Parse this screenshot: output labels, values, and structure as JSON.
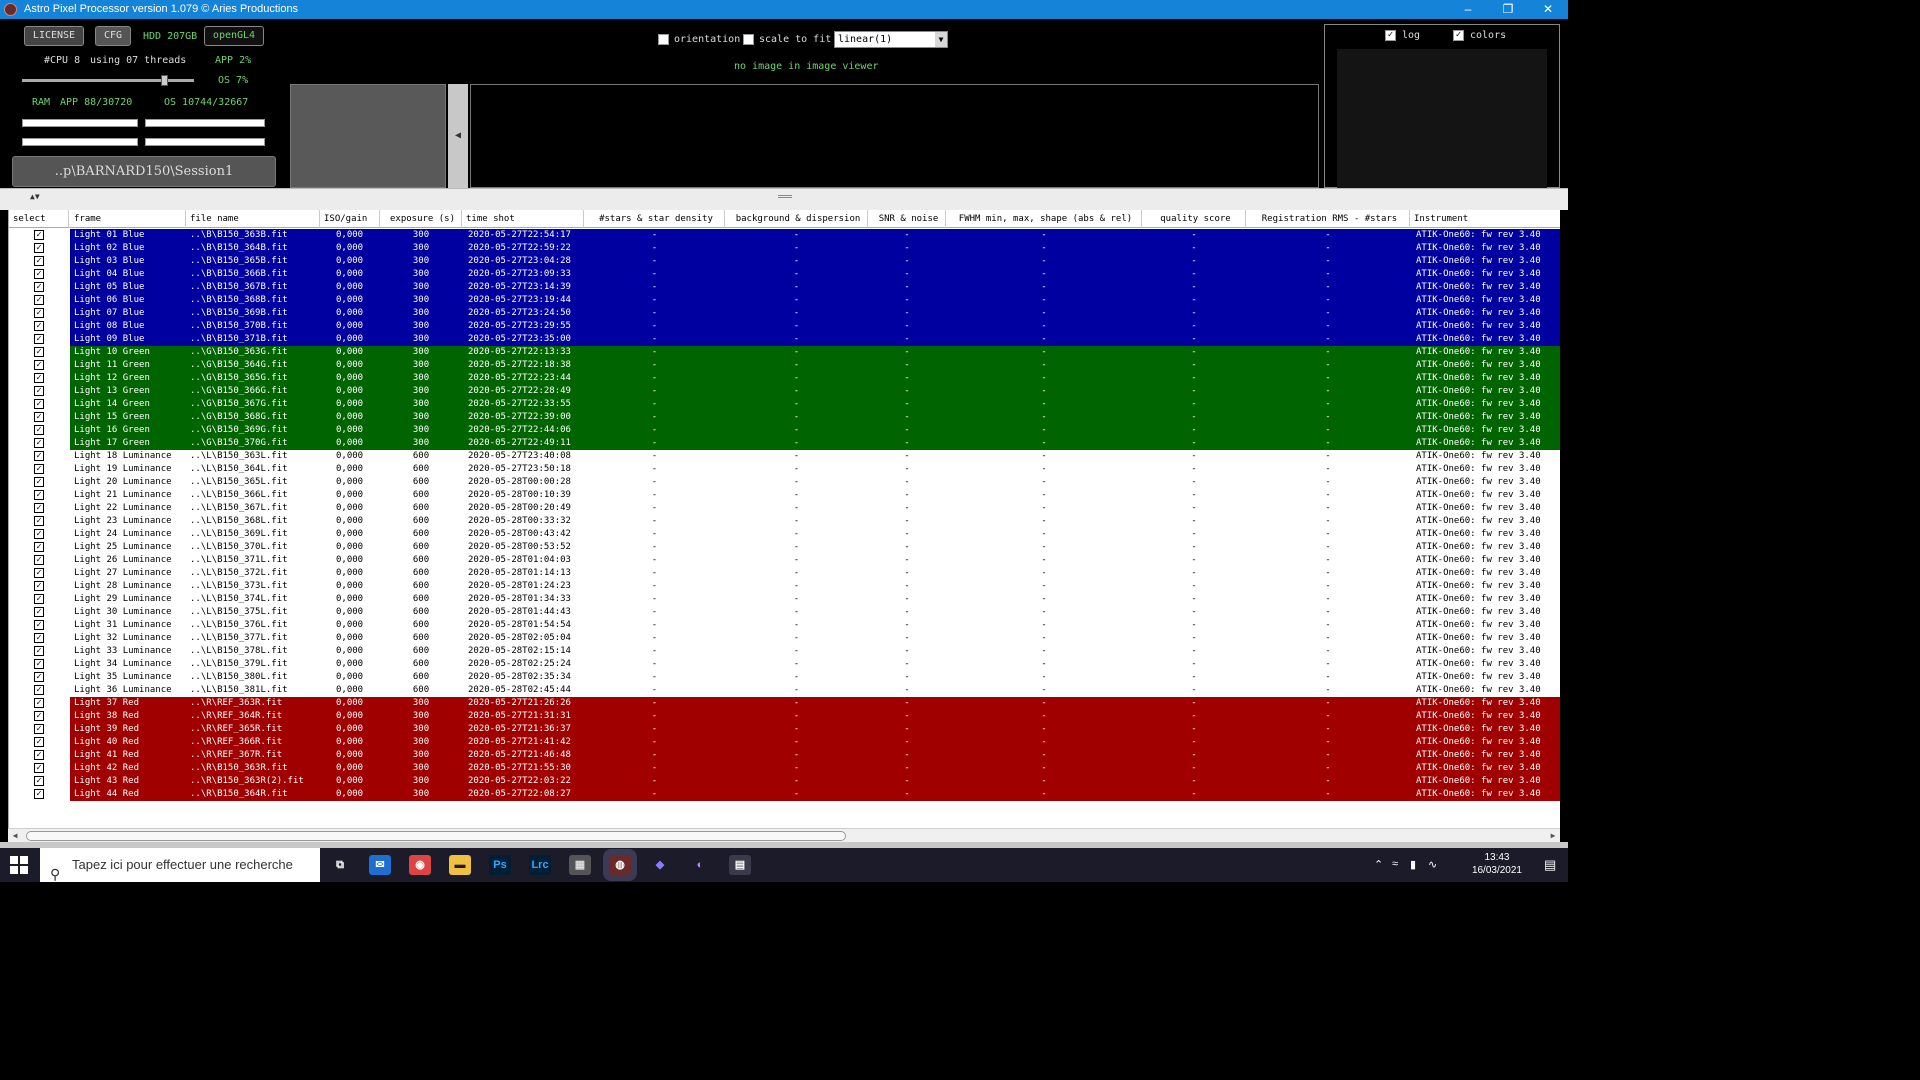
{
  "window": {
    "title": "Astro Pixel Processor version 1.079 © Aries Productions"
  },
  "top": {
    "license_label": "LICENSE",
    "cfg_label": "CFG",
    "hdd_label": "HDD 207GB",
    "opengl_label": "openGL4",
    "cpu_text": "#CPU 8",
    "threads_text": "using 07 threads",
    "app_cpu": "APP 2%",
    "os_cpu": "OS 7%",
    "ram_label": "RAM",
    "ram_app": "APP 88/30720",
    "ram_os": "OS 10744/32667",
    "session": "..p\\BARNARD150\\Session1",
    "orientation_label": "orientation",
    "scale_label": "scale to fit",
    "stretch_value": "linear(1)",
    "no_image": "no image in image viewer",
    "log_label": "log",
    "colors_label": "colors"
  },
  "colors": {
    "blue": "#0000a0",
    "green": "#006400",
    "red": "#a00000",
    "white": "#ffffff"
  },
  "table": {
    "headers": [
      "select",
      "frame",
      "file name",
      "ISO/gain",
      "exposure (s)",
      "time shot",
      "#stars & star density",
      "background & dispersion",
      "SNR & noise",
      "FWHM min, max, shape (abs & rel)",
      "quality score",
      "Registration RMS - #stars",
      "Instrument"
    ],
    "rows": [
      {
        "frame": "Light 01 Blue",
        "file": "..\\B\\B150_363B.fit",
        "iso": "0,000",
        "exp": "300",
        "time": "2020-05-27T22:54:17",
        "stars": "-",
        "bg": "-",
        "snr": "-",
        "fwhm": "-",
        "q": "-",
        "reg": "-",
        "inst": "ATIK-One60: fw rev 3.40",
        "color": "blue"
      },
      {
        "frame": "Light 02 Blue",
        "file": "..\\B\\B150_364B.fit",
        "iso": "0,000",
        "exp": "300",
        "time": "2020-05-27T22:59:22",
        "stars": "-",
        "bg": "-",
        "snr": "-",
        "fwhm": "-",
        "q": "-",
        "reg": "-",
        "inst": "ATIK-One60: fw rev 3.40",
        "color": "blue"
      },
      {
        "frame": "Light 03 Blue",
        "file": "..\\B\\B150_365B.fit",
        "iso": "0,000",
        "exp": "300",
        "time": "2020-05-27T23:04:28",
        "stars": "-",
        "bg": "-",
        "snr": "-",
        "fwhm": "-",
        "q": "-",
        "reg": "-",
        "inst": "ATIK-One60: fw rev 3.40",
        "color": "blue"
      },
      {
        "frame": "Light 04 Blue",
        "file": "..\\B\\B150_366B.fit",
        "iso": "0,000",
        "exp": "300",
        "time": "2020-05-27T23:09:33",
        "stars": "-",
        "bg": "-",
        "snr": "-",
        "fwhm": "-",
        "q": "-",
        "reg": "-",
        "inst": "ATIK-One60: fw rev 3.40",
        "color": "blue"
      },
      {
        "frame": "Light 05 Blue",
        "file": "..\\B\\B150_367B.fit",
        "iso": "0,000",
        "exp": "300",
        "time": "2020-05-27T23:14:39",
        "stars": "-",
        "bg": "-",
        "snr": "-",
        "fwhm": "-",
        "q": "-",
        "reg": "-",
        "inst": "ATIK-One60: fw rev 3.40",
        "color": "blue"
      },
      {
        "frame": "Light 06 Blue",
        "file": "..\\B\\B150_368B.fit",
        "iso": "0,000",
        "exp": "300",
        "time": "2020-05-27T23:19:44",
        "stars": "-",
        "bg": "-",
        "snr": "-",
        "fwhm": "-",
        "q": "-",
        "reg": "-",
        "inst": "ATIK-One60: fw rev 3.40",
        "color": "blue"
      },
      {
        "frame": "Light 07 Blue",
        "file": "..\\B\\B150_369B.fit",
        "iso": "0,000",
        "exp": "300",
        "time": "2020-05-27T23:24:50",
        "stars": "-",
        "bg": "-",
        "snr": "-",
        "fwhm": "-",
        "q": "-",
        "reg": "-",
        "inst": "ATIK-One60: fw rev 3.40",
        "color": "blue"
      },
      {
        "frame": "Light 08 Blue",
        "file": "..\\B\\B150_370B.fit",
        "iso": "0,000",
        "exp": "300",
        "time": "2020-05-27T23:29:55",
        "stars": "-",
        "bg": "-",
        "snr": "-",
        "fwhm": "-",
        "q": "-",
        "reg": "-",
        "inst": "ATIK-One60: fw rev 3.40",
        "color": "blue"
      },
      {
        "frame": "Light 09 Blue",
        "file": "..\\B\\B150_371B.fit",
        "iso": "0,000",
        "exp": "300",
        "time": "2020-05-27T23:35:00",
        "stars": "-",
        "bg": "-",
        "snr": "-",
        "fwhm": "-",
        "q": "-",
        "reg": "-",
        "inst": "ATIK-One60: fw rev 3.40",
        "color": "blue"
      },
      {
        "frame": "Light 10 Green",
        "file": "..\\G\\B150_363G.fit",
        "iso": "0,000",
        "exp": "300",
        "time": "2020-05-27T22:13:33",
        "stars": "-",
        "bg": "-",
        "snr": "-",
        "fwhm": "-",
        "q": "-",
        "reg": "-",
        "inst": "ATIK-One60: fw rev 3.40",
        "color": "green"
      },
      {
        "frame": "Light 11 Green",
        "file": "..\\G\\B150_364G.fit",
        "iso": "0,000",
        "exp": "300",
        "time": "2020-05-27T22:18:38",
        "stars": "-",
        "bg": "-",
        "snr": "-",
        "fwhm": "-",
        "q": "-",
        "reg": "-",
        "inst": "ATIK-One60: fw rev 3.40",
        "color": "green"
      },
      {
        "frame": "Light 12 Green",
        "file": "..\\G\\B150_365G.fit",
        "iso": "0,000",
        "exp": "300",
        "time": "2020-05-27T22:23:44",
        "stars": "-",
        "bg": "-",
        "snr": "-",
        "fwhm": "-",
        "q": "-",
        "reg": "-",
        "inst": "ATIK-One60: fw rev 3.40",
        "color": "green"
      },
      {
        "frame": "Light 13 Green",
        "file": "..\\G\\B150_366G.fit",
        "iso": "0,000",
        "exp": "300",
        "time": "2020-05-27T22:28:49",
        "stars": "-",
        "bg": "-",
        "snr": "-",
        "fwhm": "-",
        "q": "-",
        "reg": "-",
        "inst": "ATIK-One60: fw rev 3.40",
        "color": "green"
      },
      {
        "frame": "Light 14 Green",
        "file": "..\\G\\B150_367G.fit",
        "iso": "0,000",
        "exp": "300",
        "time": "2020-05-27T22:33:55",
        "stars": "-",
        "bg": "-",
        "snr": "-",
        "fwhm": "-",
        "q": "-",
        "reg": "-",
        "inst": "ATIK-One60: fw rev 3.40",
        "color": "green"
      },
      {
        "frame": "Light 15 Green",
        "file": "..\\G\\B150_368G.fit",
        "iso": "0,000",
        "exp": "300",
        "time": "2020-05-27T22:39:00",
        "stars": "-",
        "bg": "-",
        "snr": "-",
        "fwhm": "-",
        "q": "-",
        "reg": "-",
        "inst": "ATIK-One60: fw rev 3.40",
        "color": "green"
      },
      {
        "frame": "Light 16 Green",
        "file": "..\\G\\B150_369G.fit",
        "iso": "0,000",
        "exp": "300",
        "time": "2020-05-27T22:44:06",
        "stars": "-",
        "bg": "-",
        "snr": "-",
        "fwhm": "-",
        "q": "-",
        "reg": "-",
        "inst": "ATIK-One60: fw rev 3.40",
        "color": "green"
      },
      {
        "frame": "Light 17 Green",
        "file": "..\\G\\B150_370G.fit",
        "iso": "0,000",
        "exp": "300",
        "time": "2020-05-27T22:49:11",
        "stars": "-",
        "bg": "-",
        "snr": "-",
        "fwhm": "-",
        "q": "-",
        "reg": "-",
        "inst": "ATIK-One60: fw rev 3.40",
        "color": "green"
      },
      {
        "frame": "Light 18 Luminance",
        "file": "..\\L\\B150_363L.fit",
        "iso": "0,000",
        "exp": "600",
        "time": "2020-05-27T23:40:08",
        "stars": "-",
        "bg": "-",
        "snr": "-",
        "fwhm": "-",
        "q": "-",
        "reg": "-",
        "inst": "ATIK-One60: fw rev 3.40",
        "color": "white"
      },
      {
        "frame": "Light 19 Luminance",
        "file": "..\\L\\B150_364L.fit",
        "iso": "0,000",
        "exp": "600",
        "time": "2020-05-27T23:50:18",
        "stars": "-",
        "bg": "-",
        "snr": "-",
        "fwhm": "-",
        "q": "-",
        "reg": "-",
        "inst": "ATIK-One60: fw rev 3.40",
        "color": "white"
      },
      {
        "frame": "Light 20 Luminance",
        "file": "..\\L\\B150_365L.fit",
        "iso": "0,000",
        "exp": "600",
        "time": "2020-05-28T00:00:28",
        "stars": "-",
        "bg": "-",
        "snr": "-",
        "fwhm": "-",
        "q": "-",
        "reg": "-",
        "inst": "ATIK-One60: fw rev 3.40",
        "color": "white"
      },
      {
        "frame": "Light 21 Luminance",
        "file": "..\\L\\B150_366L.fit",
        "iso": "0,000",
        "exp": "600",
        "time": "2020-05-28T00:10:39",
        "stars": "-",
        "bg": "-",
        "snr": "-",
        "fwhm": "-",
        "q": "-",
        "reg": "-",
        "inst": "ATIK-One60: fw rev 3.40",
        "color": "white"
      },
      {
        "frame": "Light 22 Luminance",
        "file": "..\\L\\B150_367L.fit",
        "iso": "0,000",
        "exp": "600",
        "time": "2020-05-28T00:20:49",
        "stars": "-",
        "bg": "-",
        "snr": "-",
        "fwhm": "-",
        "q": "-",
        "reg": "-",
        "inst": "ATIK-One60: fw rev 3.40",
        "color": "white"
      },
      {
        "frame": "Light 23 Luminance",
        "file": "..\\L\\B150_368L.fit",
        "iso": "0,000",
        "exp": "600",
        "time": "2020-05-28T00:33:32",
        "stars": "-",
        "bg": "-",
        "snr": "-",
        "fwhm": "-",
        "q": "-",
        "reg": "-",
        "inst": "ATIK-One60: fw rev 3.40",
        "color": "white"
      },
      {
        "frame": "Light 24 Luminance",
        "file": "..\\L\\B150_369L.fit",
        "iso": "0,000",
        "exp": "600",
        "time": "2020-05-28T00:43:42",
        "stars": "-",
        "bg": "-",
        "snr": "-",
        "fwhm": "-",
        "q": "-",
        "reg": "-",
        "inst": "ATIK-One60: fw rev 3.40",
        "color": "white"
      },
      {
        "frame": "Light 25 Luminance",
        "file": "..\\L\\B150_370L.fit",
        "iso": "0,000",
        "exp": "600",
        "time": "2020-05-28T00:53:52",
        "stars": "-",
        "bg": "-",
        "snr": "-",
        "fwhm": "-",
        "q": "-",
        "reg": "-",
        "inst": "ATIK-One60: fw rev 3.40",
        "color": "white"
      },
      {
        "frame": "Light 26 Luminance",
        "file": "..\\L\\B150_371L.fit",
        "iso": "0,000",
        "exp": "600",
        "time": "2020-05-28T01:04:03",
        "stars": "-",
        "bg": "-",
        "snr": "-",
        "fwhm": "-",
        "q": "-",
        "reg": "-",
        "inst": "ATIK-One60: fw rev 3.40",
        "color": "white"
      },
      {
        "frame": "Light 27 Luminance",
        "file": "..\\L\\B150_372L.fit",
        "iso": "0,000",
        "exp": "600",
        "time": "2020-05-28T01:14:13",
        "stars": "-",
        "bg": "-",
        "snr": "-",
        "fwhm": "-",
        "q": "-",
        "reg": "-",
        "inst": "ATIK-One60: fw rev 3.40",
        "color": "white"
      },
      {
        "frame": "Light 28 Luminance",
        "file": "..\\L\\B150_373L.fit",
        "iso": "0,000",
        "exp": "600",
        "time": "2020-05-28T01:24:23",
        "stars": "-",
        "bg": "-",
        "snr": "-",
        "fwhm": "-",
        "q": "-",
        "reg": "-",
        "inst": "ATIK-One60: fw rev 3.40",
        "color": "white"
      },
      {
        "frame": "Light 29 Luminance",
        "file": "..\\L\\B150_374L.fit",
        "iso": "0,000",
        "exp": "600",
        "time": "2020-05-28T01:34:33",
        "stars": "-",
        "bg": "-",
        "snr": "-",
        "fwhm": "-",
        "q": "-",
        "reg": "-",
        "inst": "ATIK-One60: fw rev 3.40",
        "color": "white"
      },
      {
        "frame": "Light 30 Luminance",
        "file": "..\\L\\B150_375L.fit",
        "iso": "0,000",
        "exp": "600",
        "time": "2020-05-28T01:44:43",
        "stars": "-",
        "bg": "-",
        "snr": "-",
        "fwhm": "-",
        "q": "-",
        "reg": "-",
        "inst": "ATIK-One60: fw rev 3.40",
        "color": "white"
      },
      {
        "frame": "Light 31 Luminance",
        "file": "..\\L\\B150_376L.fit",
        "iso": "0,000",
        "exp": "600",
        "time": "2020-05-28T01:54:54",
        "stars": "-",
        "bg": "-",
        "snr": "-",
        "fwhm": "-",
        "q": "-",
        "reg": "-",
        "inst": "ATIK-One60: fw rev 3.40",
        "color": "white"
      },
      {
        "frame": "Light 32 Luminance",
        "file": "..\\L\\B150_377L.fit",
        "iso": "0,000",
        "exp": "600",
        "time": "2020-05-28T02:05:04",
        "stars": "-",
        "bg": "-",
        "snr": "-",
        "fwhm": "-",
        "q": "-",
        "reg": "-",
        "inst": "ATIK-One60: fw rev 3.40",
        "color": "white"
      },
      {
        "frame": "Light 33 Luminance",
        "file": "..\\L\\B150_378L.fit",
        "iso": "0,000",
        "exp": "600",
        "time": "2020-05-28T02:15:14",
        "stars": "-",
        "bg": "-",
        "snr": "-",
        "fwhm": "-",
        "q": "-",
        "reg": "-",
        "inst": "ATIK-One60: fw rev 3.40",
        "color": "white"
      },
      {
        "frame": "Light 34 Luminance",
        "file": "..\\L\\B150_379L.fit",
        "iso": "0,000",
        "exp": "600",
        "time": "2020-05-28T02:25:24",
        "stars": "-",
        "bg": "-",
        "snr": "-",
        "fwhm": "-",
        "q": "-",
        "reg": "-",
        "inst": "ATIK-One60: fw rev 3.40",
        "color": "white"
      },
      {
        "frame": "Light 35 Luminance",
        "file": "..\\L\\B150_380L.fit",
        "iso": "0,000",
        "exp": "600",
        "time": "2020-05-28T02:35:34",
        "stars": "-",
        "bg": "-",
        "snr": "-",
        "fwhm": "-",
        "q": "-",
        "reg": "-",
        "inst": "ATIK-One60: fw rev 3.40",
        "color": "white"
      },
      {
        "frame": "Light 36 Luminance",
        "file": "..\\L\\B150_381L.fit",
        "iso": "0,000",
        "exp": "600",
        "time": "2020-05-28T02:45:44",
        "stars": "-",
        "bg": "-",
        "snr": "-",
        "fwhm": "-",
        "q": "-",
        "reg": "-",
        "inst": "ATIK-One60: fw rev 3.40",
        "color": "white"
      },
      {
        "frame": "Light 37 Red",
        "file": "..\\R\\REF_363R.fit",
        "iso": "0,000",
        "exp": "300",
        "time": "2020-05-27T21:26:26",
        "stars": "-",
        "bg": "-",
        "snr": "-",
        "fwhm": "-",
        "q": "-",
        "reg": "-",
        "inst": "ATIK-One60: fw rev 3.40",
        "color": "red"
      },
      {
        "frame": "Light 38 Red",
        "file": "..\\R\\REF_364R.fit",
        "iso": "0,000",
        "exp": "300",
        "time": "2020-05-27T21:31:31",
        "stars": "-",
        "bg": "-",
        "snr": "-",
        "fwhm": "-",
        "q": "-",
        "reg": "-",
        "inst": "ATIK-One60: fw rev 3.40",
        "color": "red"
      },
      {
        "frame": "Light 39 Red",
        "file": "..\\R\\REF_365R.fit",
        "iso": "0,000",
        "exp": "300",
        "time": "2020-05-27T21:36:37",
        "stars": "-",
        "bg": "-",
        "snr": "-",
        "fwhm": "-",
        "q": "-",
        "reg": "-",
        "inst": "ATIK-One60: fw rev 3.40",
        "color": "red"
      },
      {
        "frame": "Light 40 Red",
        "file": "..\\R\\REF_366R.fit",
        "iso": "0,000",
        "exp": "300",
        "time": "2020-05-27T21:41:42",
        "stars": "-",
        "bg": "-",
        "snr": "-",
        "fwhm": "-",
        "q": "-",
        "reg": "-",
        "inst": "ATIK-One60: fw rev 3.40",
        "color": "red"
      },
      {
        "frame": "Light 41 Red",
        "file": "..\\R\\REF_367R.fit",
        "iso": "0,000",
        "exp": "300",
        "time": "2020-05-27T21:46:48",
        "stars": "-",
        "bg": "-",
        "snr": "-",
        "fwhm": "-",
        "q": "-",
        "reg": "-",
        "inst": "ATIK-One60: fw rev 3.40",
        "color": "red"
      },
      {
        "frame": "Light 42 Red",
        "file": "..\\R\\B150_363R.fit",
        "iso": "0,000",
        "exp": "300",
        "time": "2020-05-27T21:55:30",
        "stars": "-",
        "bg": "-",
        "snr": "-",
        "fwhm": "-",
        "q": "-",
        "reg": "-",
        "inst": "ATIK-One60: fw rev 3.40",
        "color": "red"
      },
      {
        "frame": "Light 43 Red",
        "file": "..\\R\\B150_363R(2).fit",
        "iso": "0,000",
        "exp": "300",
        "time": "2020-05-27T22:03:22",
        "stars": "-",
        "bg": "-",
        "snr": "-",
        "fwhm": "-",
        "q": "-",
        "reg": "-",
        "inst": "ATIK-One60: fw rev 3.40",
        "color": "red"
      },
      {
        "frame": "Light 44 Red",
        "file": "..\\R\\B150_364R.fit",
        "iso": "0,000",
        "exp": "300",
        "time": "2020-05-27T22:08:27",
        "stars": "-",
        "bg": "-",
        "snr": "-",
        "fwhm": "-",
        "q": "-",
        "reg": "-",
        "inst": "ATIK-One60: fw rev 3.40",
        "color": "red"
      }
    ]
  },
  "taskbar": {
    "search_placeholder": "Tapez ici pour effectuer une recherche",
    "time": "13:43",
    "date": "16/03/2021",
    "apps": [
      {
        "name": "task-view",
        "glyph": "⧉",
        "color": "#ffffff",
        "bg": "transparent"
      },
      {
        "name": "mail",
        "glyph": "✉",
        "color": "#ffffff",
        "bg": "#1f6fd0"
      },
      {
        "name": "chrome",
        "glyph": "◉",
        "color": "#ffffff",
        "bg": "#d44"
      },
      {
        "name": "explorer",
        "glyph": "▬",
        "color": "#1b1b2a",
        "bg": "#f0c040"
      },
      {
        "name": "photoshop",
        "glyph": "Ps",
        "color": "#31a8ff",
        "bg": "#001e36"
      },
      {
        "name": "lightroom",
        "glyph": "Lrc",
        "color": "#31a8ff",
        "bg": "#001e36"
      },
      {
        "name": "app-generic",
        "glyph": "▦",
        "color": "#dddddd",
        "bg": "#555"
      },
      {
        "name": "astro-pixel-processor",
        "glyph": "◍",
        "color": "#ffffff",
        "bg": "#6a2a2a"
      },
      {
        "name": "app-cube",
        "glyph": "◆",
        "color": "#8a7cff",
        "bg": "transparent"
      },
      {
        "name": "app-saturn",
        "glyph": "◐",
        "color": "#c08cff",
        "bg": "transparent"
      },
      {
        "name": "calculator",
        "glyph": "▤",
        "color": "#ffffff",
        "bg": "#3a3a4a"
      }
    ]
  }
}
